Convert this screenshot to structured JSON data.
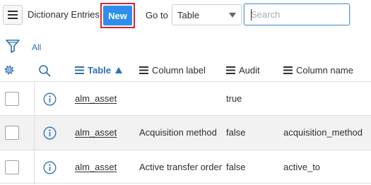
{
  "toolbar": {
    "title": "Dictionary Entries",
    "new_label": "New",
    "goto_label": "Go to",
    "goto_select_value": "Table",
    "search_placeholder": "Search"
  },
  "filter": {
    "all_label": "All"
  },
  "columns": [
    {
      "label": "Table",
      "sorted": "ascending"
    },
    {
      "label": "Column label"
    },
    {
      "label": "Audit"
    },
    {
      "label": "Column name"
    }
  ],
  "rows": [
    {
      "table": "alm_asset",
      "column_label": "",
      "audit": "true",
      "column_name": ""
    },
    {
      "table": "alm_asset",
      "column_label": "Acquisition method",
      "audit": "false",
      "column_name": "acquisition_method"
    },
    {
      "table": "alm_asset",
      "column_label": "Active transfer order",
      "audit": "false",
      "column_name": "active_to"
    }
  ],
  "colors": {
    "accent": "#2e8ded",
    "highlight_outline": "#d8262f",
    "link": "#2e6fb6"
  },
  "icons": [
    "hamburger-menu-icon",
    "chevron-down-icon",
    "filter-icon",
    "gear-icon",
    "search-icon",
    "column-lines-icon",
    "sort-ascending-icon",
    "info-icon"
  ]
}
